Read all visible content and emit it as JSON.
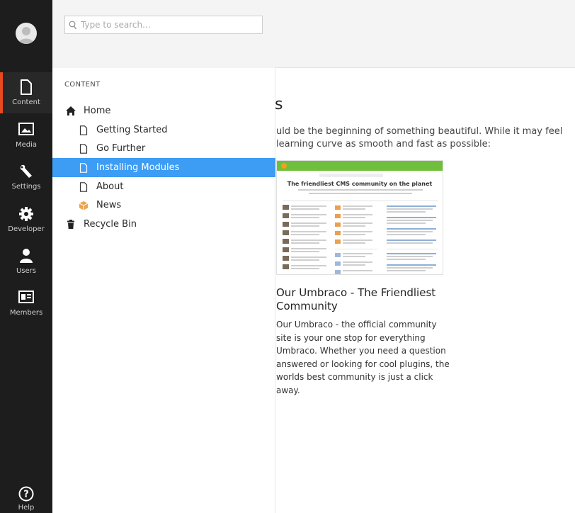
{
  "app_bar": {
    "sections": [
      {
        "label": "Content",
        "icon": "document-icon",
        "active": true
      },
      {
        "label": "Media",
        "icon": "image-icon",
        "active": false
      },
      {
        "label": "Settings",
        "icon": "wrench-icon",
        "active": false
      },
      {
        "label": "Developer",
        "icon": "gear-icon",
        "active": false
      },
      {
        "label": "Users",
        "icon": "user-icon",
        "active": false
      },
      {
        "label": "Members",
        "icon": "id-card-icon",
        "active": false
      }
    ],
    "help_label": "Help",
    "accent_color": "#e64a1e",
    "background_color": "#1d1d1d"
  },
  "tree": {
    "search_placeholder": "Type to search...",
    "section_title": "CONTENT",
    "items": [
      {
        "label": "Home",
        "icon": "home-icon",
        "selected": false
      },
      {
        "label": "Getting Started",
        "icon": "page-icon",
        "selected": false
      },
      {
        "label": "Go Further",
        "icon": "page-icon",
        "selected": false
      },
      {
        "label": "Installing Modules",
        "icon": "page-icon",
        "selected": true
      },
      {
        "label": "About",
        "icon": "page-icon",
        "selected": false
      },
      {
        "label": "News",
        "icon": "box-icon",
        "selected": false
      },
      {
        "label": "Recycle Bin",
        "icon": "trash-icon",
        "selected": false
      }
    ],
    "selected_color": "#3d9cf4"
  },
  "main": {
    "heading_fragment": "s",
    "intro_line_1": "uld be the beginning of something beautiful. While it may feel",
    "intro_line_2": "learning curve as smooth and fast as possible:",
    "screenshot": {
      "site_title": "The friendliest CMS community on the planet"
    },
    "card_title": "Our Umbraco - The Friendliest Community",
    "card_description": "Our Umbraco - the official community site is your one stop for everything Umbraco. Whether you need a question answered or looking for cool plugins, the worlds best community is just a click away."
  }
}
